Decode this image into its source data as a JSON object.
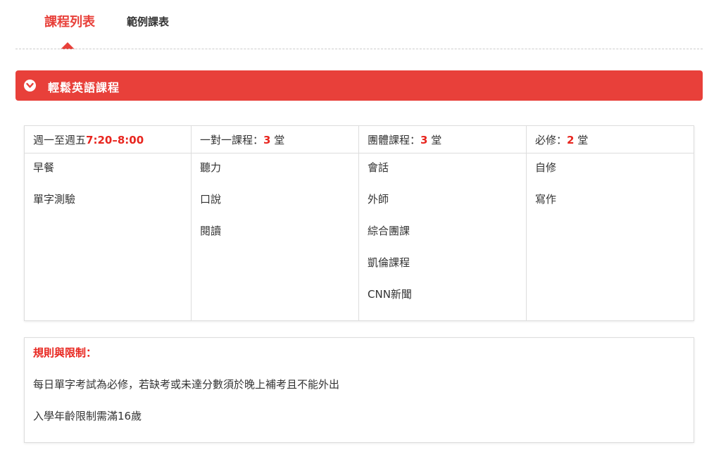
{
  "tabs": [
    {
      "label": "課程列表",
      "active": true
    },
    {
      "label": "範例課表",
      "active": false
    }
  ],
  "accordion": {
    "title": "輕鬆英語課程",
    "icon": "chevron-down-circle-icon",
    "color": "#e8403a"
  },
  "schedule": {
    "columns": [
      {
        "head_prefix": "週一至週五",
        "head_highlight": "7:20–8:00",
        "head_suffix": "",
        "items": [
          "早餐",
          "單字測驗"
        ]
      },
      {
        "head_prefix": "一對一課程：",
        "head_highlight": "3",
        "head_suffix": " 堂",
        "items": [
          "聽力",
          "口說",
          "閱讀"
        ]
      },
      {
        "head_prefix": "團體課程：",
        "head_highlight": "3",
        "head_suffix": " 堂",
        "items": [
          "會話",
          "外師",
          "綜合團課",
          "凱倫課程",
          "CNN新聞"
        ]
      },
      {
        "head_prefix": "必修：",
        "head_highlight": "2",
        "head_suffix": " 堂",
        "items": [
          "自修",
          "寫作"
        ]
      }
    ]
  },
  "rules": {
    "title": "規則與限制：",
    "lines": [
      "每日單字考試為必修，若缺考或未達分數須於晚上補考且不能外出",
      "入學年齡限制需滿16歲"
    ]
  },
  "colors": {
    "accent": "#e8403a",
    "highlight": "#e8261f"
  }
}
